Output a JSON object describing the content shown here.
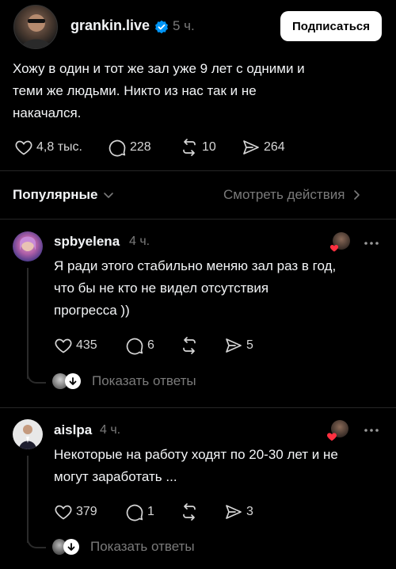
{
  "post": {
    "username": "grankin.live",
    "time": "5 ч.",
    "subscribe_label": "Подписаться",
    "text_lines": [
      "Хожу в один и тот же зал уже 9 лет с одними и",
      "теми же людьми. Никто из нас так и не",
      "накачался."
    ],
    "likes": "4,8 тыс.",
    "comments": "228",
    "reposts": "10",
    "shares": "264"
  },
  "sort": {
    "label": "Популярные",
    "view_activity": "Смотреть действия"
  },
  "replies": [
    {
      "username": "spbyelena",
      "time": "4 ч.",
      "text_lines": [
        "Я ради этого стабильно меняю зал раз в год,",
        "что бы не кто не видел отсутствия",
        "прогресса ))"
      ],
      "likes": "435",
      "comments": "6",
      "reposts": "",
      "shares": "5",
      "show_replies": "Показать ответы"
    },
    {
      "username": "aislpa",
      "time": "4 ч.",
      "text_lines": [
        "Некоторые на работу ходят по 20-30 лет и не",
        "могут заработать ..."
      ],
      "likes": "379",
      "comments": "1",
      "reposts": "",
      "shares": "3",
      "show_replies": "Показать ответы"
    }
  ],
  "icons": {
    "verified": "verified-badge-icon",
    "like": "heart-icon",
    "comment": "comment-icon",
    "repost": "repost-icon",
    "share": "share-icon",
    "more": "more-icon",
    "chevron": "chevron-down-icon",
    "arrow": "chevron-right-icon"
  },
  "colors": {
    "background": "#000000",
    "text": "#f3f5f7",
    "muted": "#7a7a7a",
    "verified": "#0095f6",
    "like_red": "#ff3040",
    "button_bg": "#ffffff"
  }
}
